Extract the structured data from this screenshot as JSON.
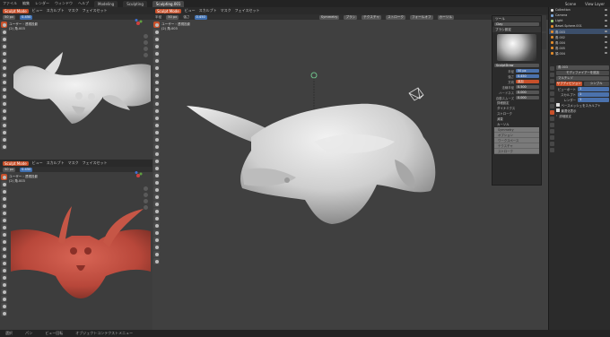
{
  "app": {
    "menus": [
      "ファイル",
      "編集",
      "レンダー",
      "ウィンドウ",
      "ヘルプ"
    ],
    "tabs": [
      "Modeling",
      "Sculpting",
      "Sculpting.001"
    ],
    "active_tab": "Sculpting.001",
    "scene": "Scene",
    "view_layer": "View Layer"
  },
  "left_top": {
    "mode": "Sculpt Mode",
    "menu": [
      "ビュー",
      "スカルプト",
      "マスク",
      "フェイスセット"
    ],
    "brush_size": "50 px",
    "strength": "0.450",
    "view_label": "ユーザー・透視投影",
    "object_label": "(2) 角.003"
  },
  "left_bottom": {
    "mode": "Sculpt Mode",
    "menu": [
      "ビュー",
      "スカルプト",
      "マスク",
      "フェイスセット"
    ],
    "brush_size": "50 px",
    "strength": "0.450",
    "view_label": "ユーザー・透視投影",
    "object_label": "(2) 角.003"
  },
  "center": {
    "mode": "Sculpt Mode",
    "menu": [
      "ビュー",
      "スカルプト",
      "マスク",
      "フェイスセット"
    ],
    "brush_label": "半径",
    "brush_size": "50 px",
    "strength_label": "強さ",
    "strength": "0.450",
    "right_menu": [
      "Symmetry",
      "ブラシ",
      "テクスチャ",
      "ストローク",
      "フォールオフ",
      "カーソル"
    ],
    "view_label": "ユーザー・透視投影",
    "object_label": "(2) 角.003"
  },
  "npanel": {
    "sections": [
      "ツール",
      "ブラシ設定"
    ],
    "matcap": "Clay",
    "brush_name": "SculptDraw",
    "rows": [
      {
        "label": "半径",
        "value": "50 px"
      },
      {
        "label": "強さ",
        "value": "0.450"
      },
      {
        "label": "方向",
        "value": "追加"
      },
      {
        "label": "法線半径",
        "value": "0.500"
      },
      {
        "label": "ハードネス",
        "value": "0.000"
      },
      {
        "label": "自動スムーズ",
        "value": "0.000"
      }
    ],
    "subsections": [
      "詳細設定",
      "ダイナミクス",
      "ストローク",
      "減衰",
      "カーソル"
    ],
    "grey_rows": [
      "Symmetry",
      "オプション",
      "ワークスペース",
      "テクスチャ",
      "ストローク"
    ]
  },
  "outliner": {
    "items": [
      {
        "name": "Collection",
        "selected": false
      },
      {
        "name": "Camera",
        "selected": false
      },
      {
        "name": "Light",
        "selected": false
      },
      {
        "name": "Basel.Sphere.001",
        "selected": false
      },
      {
        "name": "角.003",
        "selected": true
      },
      {
        "name": "角.002",
        "selected": false
      },
      {
        "name": "角.004",
        "selected": false
      },
      {
        "name": "角.005",
        "selected": false
      },
      {
        "name": "頭.004",
        "selected": false
      }
    ]
  },
  "properties": {
    "header": "角.003",
    "section": "モディファイアーを追加",
    "modifier": "マルチレゾ",
    "buttons": [
      "サブディビジョン",
      "シンプル"
    ],
    "levels": [
      {
        "label": "ビューポート",
        "value": "1"
      },
      {
        "label": "スカルプト",
        "value": "1"
      },
      {
        "label": "レンダー",
        "value": "1"
      }
    ],
    "sculpt_option": "ベースメッシュをスカルプト",
    "optimal_label": "最適化表示",
    "subsection": "詳細設定"
  },
  "status": [
    "選択",
    "パン",
    "ビュー回転",
    "オブジェクトコンテクストメニュー"
  ],
  "colors": {
    "viewport": "#3d3d3d",
    "accent": "#c8502a",
    "sculpt_red": "#b8473a",
    "sculpt_white": "#d8d8d8"
  }
}
